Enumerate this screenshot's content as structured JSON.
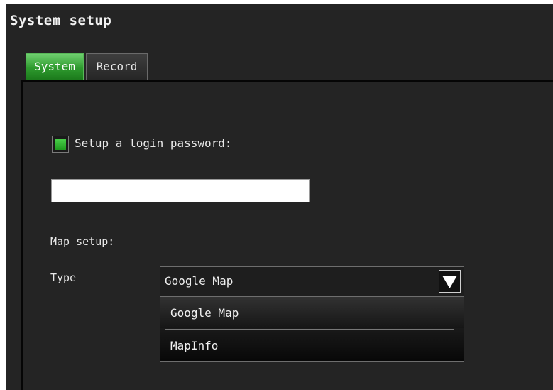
{
  "window": {
    "title": "System setup"
  },
  "tabs": [
    {
      "label": "System",
      "active": true
    },
    {
      "label": "Record",
      "active": false
    }
  ],
  "login": {
    "checkbox_checked": true,
    "label": "Setup a login password:",
    "password_value": ""
  },
  "map": {
    "section_label": "Map setup:",
    "type_label": "Type",
    "selected": "Google Map",
    "options": [
      "Google Map",
      "MapInfo"
    ]
  },
  "icons": {
    "dropdown": "triangle-down-icon"
  },
  "colors": {
    "window_bg": "#242424",
    "accent_green": "#2e9a2e",
    "panel_border": "#050505"
  }
}
